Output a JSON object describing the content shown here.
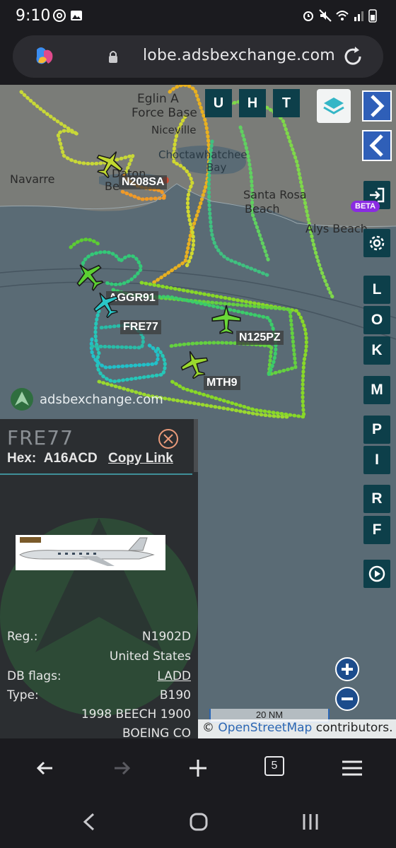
{
  "status_bar": {
    "time": "9:10",
    "icons": [
      "threads-icon",
      "gallery-icon",
      "alarm-icon",
      "mute-icon",
      "wifi-icon",
      "signal-icon",
      "battery-icon"
    ]
  },
  "browser": {
    "url": "lobe.adsbexchange.com",
    "tab_count": "5"
  },
  "map": {
    "place_labels": {
      "eglin": "Eglin A",
      "force_base": "Force Base",
      "niceville": "Niceville",
      "choctawhatchee": "Choctawhatchee",
      "bay": "Bay",
      "navarre": "Navarre",
      "santa_rosa": "Santa Rosa",
      "beach": "Beach",
      "alys_beach": "Alys Beach",
      "destin_a": "Daton",
      "destin_b": "Be"
    },
    "top_buttons": [
      "U",
      "H",
      "T"
    ],
    "side_letters": [
      "L",
      "O",
      "K",
      "M",
      "P",
      "I",
      "R",
      "F"
    ],
    "beta_label": "BETA",
    "aircraft": [
      {
        "callsign": "N208SA"
      },
      {
        "callsign": "AGGR91"
      },
      {
        "callsign": "FRE77"
      },
      {
        "callsign": "N125PZ"
      },
      {
        "callsign": "MTH9"
      }
    ],
    "brand": "adsbexchange.com",
    "scale_label": "20 NM",
    "attribution_symbol": "©",
    "attribution_link": "OpenStreetMap",
    "attribution_rest": "contributors."
  },
  "panel": {
    "callsign": "FRE77",
    "hex_label": "Hex:",
    "hex_value": "A16ACD",
    "copy_link": "Copy Link",
    "fields": [
      {
        "key": "Reg.:",
        "value": "N1902D"
      },
      {
        "key": "",
        "value": "United States"
      },
      {
        "key": "DB flags:",
        "value": "LADD"
      },
      {
        "key": "Type:",
        "value": "B190"
      },
      {
        "key": "",
        "value": "1998 BEECH 1900"
      },
      {
        "key": "",
        "value": "BOEING CO"
      }
    ]
  },
  "colors": {
    "accent": "#0d3f4a",
    "water": "#5a6b75",
    "land": "#7a7c78",
    "beta": "#8a2be2"
  }
}
